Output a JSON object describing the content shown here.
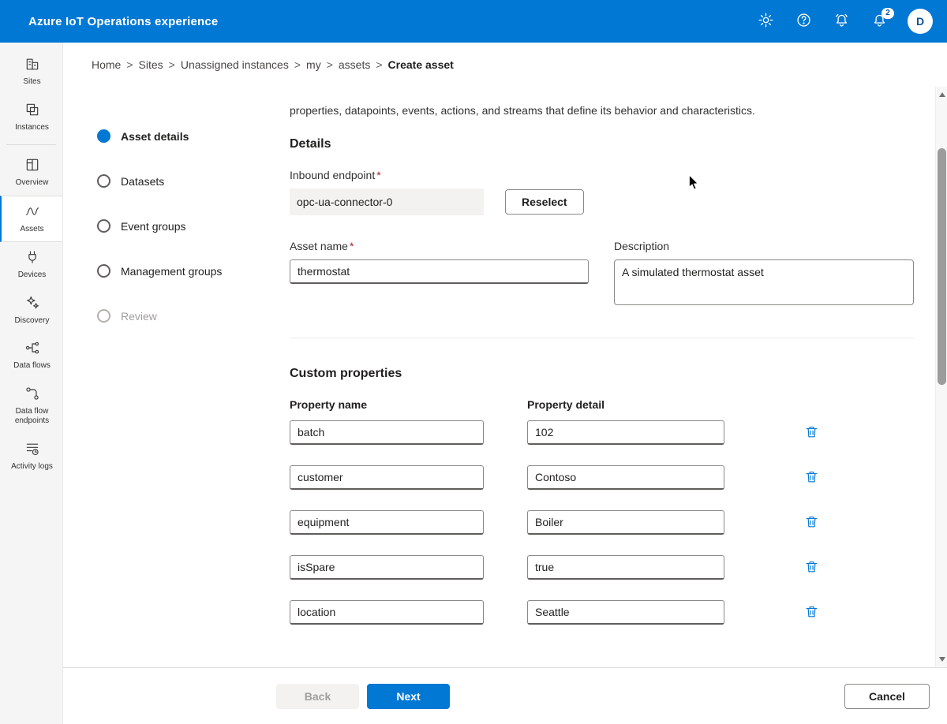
{
  "topbar": {
    "title": "Azure IoT Operations experience",
    "badge_count": "2",
    "avatar_initial": "D"
  },
  "breadcrumb": {
    "separator": ">",
    "items": [
      "Home",
      "Sites",
      "Unassigned instances",
      "my",
      "assets"
    ],
    "current": "Create asset"
  },
  "rail": {
    "items": [
      {
        "label": "Sites"
      },
      {
        "label": "Instances"
      },
      {
        "label": "Overview"
      },
      {
        "label": "Assets"
      },
      {
        "label": "Devices"
      },
      {
        "label": "Discovery"
      },
      {
        "label": "Data flows"
      },
      {
        "label": "Data flow endpoints"
      },
      {
        "label": "Activity logs"
      }
    ]
  },
  "steps": [
    {
      "label": "Asset details"
    },
    {
      "label": "Datasets"
    },
    {
      "label": "Event groups"
    },
    {
      "label": "Management groups"
    },
    {
      "label": "Review"
    }
  ],
  "content": {
    "intro": "properties, datapoints, events, actions, and streams that define its behavior and characteristics.",
    "details": {
      "heading": "Details",
      "inbound_endpoint": {
        "label": "Inbound endpoint",
        "required": "*",
        "value": "opc-ua-connector-0",
        "reselect_label": "Reselect"
      },
      "asset_name": {
        "label": "Asset name",
        "required": "*",
        "value": "thermostat"
      },
      "description": {
        "label": "Description",
        "value": "A simulated thermostat asset"
      }
    },
    "custom_properties": {
      "heading": "Custom properties",
      "columns": [
        "Property name",
        "Property detail"
      ],
      "rows": [
        {
          "name": "batch",
          "detail": "102"
        },
        {
          "name": "customer",
          "detail": "Contoso"
        },
        {
          "name": "equipment",
          "detail": "Boiler"
        },
        {
          "name": "isSpare",
          "detail": "true"
        },
        {
          "name": "location",
          "detail": "Seattle"
        }
      ]
    }
  },
  "footer": {
    "back_label": "Back",
    "next_label": "Next",
    "cancel_label": "Cancel"
  },
  "colors": {
    "accent": "#0078d4",
    "topbar": "#0078d4",
    "required": "#a4262c"
  }
}
